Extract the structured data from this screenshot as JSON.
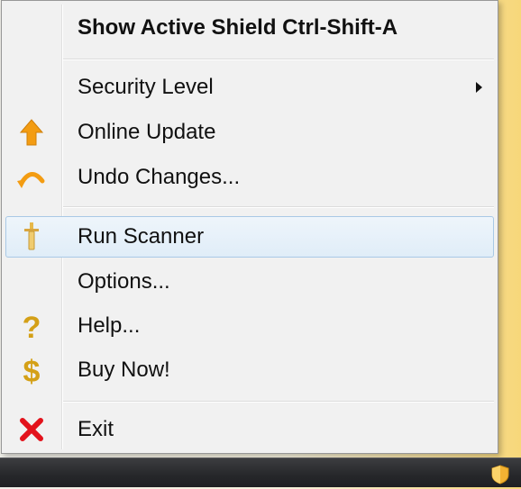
{
  "menu": {
    "header_label": "Show Active Shield  Ctrl-Shift-A",
    "items": [
      {
        "label": "Security Level",
        "icon": "none",
        "has_submenu": true
      },
      {
        "label": "Online Update",
        "icon": "up-arrow-icon"
      },
      {
        "label": "Undo Changes...",
        "icon": "undo-arrow-icon"
      },
      {
        "label": "Run Scanner",
        "icon": "sword-icon"
      },
      {
        "label": "Options...",
        "icon": "none"
      },
      {
        "label": "Help...",
        "icon": "question-icon"
      },
      {
        "label": "Buy Now!",
        "icon": "dollar-icon"
      },
      {
        "label": "Exit",
        "icon": "red-x-icon"
      }
    ]
  },
  "colors": {
    "accent_orange": "#f39c12",
    "gold": "#d4a017",
    "exit_red": "#e3121b",
    "hover_border": "#a9c9e6"
  }
}
